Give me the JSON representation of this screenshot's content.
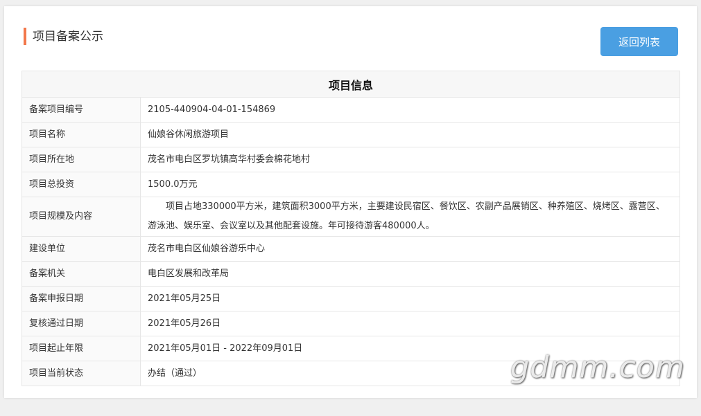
{
  "header": {
    "title": "项目备案公示",
    "back_label": "返回列表"
  },
  "table": {
    "heading": "项目信息",
    "rows": [
      {
        "label": "备案项目编号",
        "value": "2105-440904-04-01-154869"
      },
      {
        "label": "项目名称",
        "value": "仙娘谷休闲旅游项目"
      },
      {
        "label": "项目所在地",
        "value": "茂名市电白区罗坑镇高华村委会棉花地村"
      },
      {
        "label": "项目总投资",
        "value": "1500.0万元"
      },
      {
        "label": "项目规模及内容",
        "value": "项目占地330000平方米，建筑面积3000平方米，主要建设民宿区、餐饮区、农副产品展销区、种养殖区、烧烤区、露营区、游泳池、娱乐室、会议室以及其他配套设施。年可接待游客480000人。"
      },
      {
        "label": "建设单位",
        "value": "茂名市电白区仙娘谷游乐中心"
      },
      {
        "label": "备案机关",
        "value": "电白区发展和改革局"
      },
      {
        "label": "备案申报日期",
        "value": "2021年05月25日"
      },
      {
        "label": "复核通过日期",
        "value": "2021年05月26日"
      },
      {
        "label": "项目起止年限",
        "value": "2021年05月01日 - 2022年09月01日"
      },
      {
        "label": "项目当前状态",
        "value": "办结（通过）"
      }
    ]
  },
  "watermark": "gdmm.com",
  "colors": {
    "accent_bar": "#f2784b",
    "button_bg": "#4a9fe2"
  }
}
